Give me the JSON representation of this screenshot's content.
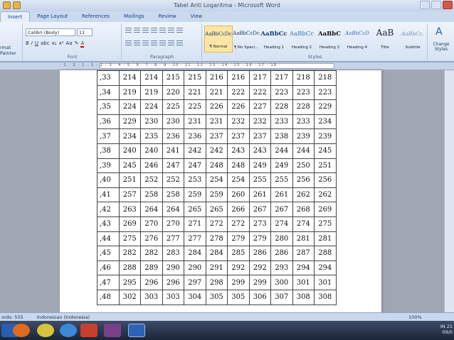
{
  "window": {
    "title": "Tabel Anti Logaritma - Microsoft Word"
  },
  "tabs": [
    "Insert",
    "Page Layout",
    "References",
    "Mailings",
    "Review",
    "View"
  ],
  "ribbon": {
    "clipboard": {
      "format_painter": "rmat Painter"
    },
    "font": {
      "name": "Calibri (Body)",
      "size": "11",
      "label": "Font"
    },
    "paragraph": {
      "label": "Paragraph"
    },
    "styles": {
      "label": "Styles",
      "items": [
        {
          "sample": "AaBbCcDc",
          "name": "¶ Normal"
        },
        {
          "sample": "AaBbCcDc",
          "name": "¶ No Spaci..."
        },
        {
          "sample": "AaBbCc",
          "name": "Heading 1"
        },
        {
          "sample": "AaBbCc",
          "name": "Heading 2"
        },
        {
          "sample": "AaBbC",
          "name": "Heading 3"
        },
        {
          "sample": "AaBbCcD",
          "name": "Heading 4"
        },
        {
          "sample": "AaB",
          "name": "Title"
        },
        {
          "sample": "AaBbCc.",
          "name": "Subtitle"
        }
      ],
      "change_styles": "Change Styles"
    }
  },
  "table": {
    "rows": [
      {
        "key": ",33",
        "values": [
          "214",
          "214",
          "215",
          "215",
          "216",
          "216",
          "217",
          "217",
          "218",
          "218"
        ]
      },
      {
        "key": ",34",
        "values": [
          "219",
          "219",
          "220",
          "221",
          "221",
          "222",
          "222",
          "223",
          "223",
          "223"
        ]
      },
      {
        "key": ",35",
        "values": [
          "224",
          "224",
          "225",
          "225",
          "226",
          "226",
          "227",
          "228",
          "228",
          "229"
        ]
      },
      {
        "key": ",36",
        "values": [
          "229",
          "230",
          "230",
          "231",
          "231",
          "232",
          "232",
          "233",
          "233",
          "234"
        ]
      },
      {
        "key": ",37",
        "values": [
          "234",
          "235",
          "236",
          "236",
          "237",
          "237",
          "237",
          "238",
          "239",
          "239"
        ]
      },
      {
        "key": ",38",
        "values": [
          "240",
          "240",
          "241",
          "242",
          "242",
          "243",
          "243",
          "244",
          "244",
          "245"
        ]
      },
      {
        "key": ",39",
        "values": [
          "245",
          "246",
          "247",
          "247",
          "248",
          "248",
          "249",
          "249",
          "250",
          "251"
        ]
      },
      {
        "key": ",40",
        "values": [
          "251",
          "252",
          "252",
          "253",
          "254",
          "254",
          "255",
          "255",
          "256",
          "256"
        ]
      },
      {
        "key": ",41",
        "values": [
          "257",
          "258",
          "258",
          "259",
          "259",
          "260",
          "261",
          "261",
          "262",
          "262"
        ]
      },
      {
        "key": ",42",
        "values": [
          "263",
          "264",
          "264",
          "265",
          "265",
          "266",
          "267",
          "267",
          "268",
          "269"
        ]
      },
      {
        "key": ",43",
        "values": [
          "269",
          "270",
          "270",
          "271",
          "272",
          "272",
          "273",
          "274",
          "274",
          "275"
        ]
      },
      {
        "key": ",44",
        "values": [
          "275",
          "276",
          "277",
          "277",
          "278",
          "279",
          "279",
          "280",
          "281",
          "281"
        ]
      },
      {
        "key": ",45",
        "values": [
          "282",
          "282",
          "283",
          "284",
          "284",
          "285",
          "286",
          "286",
          "287",
          "288"
        ]
      },
      {
        "key": ",46",
        "values": [
          "288",
          "289",
          "290",
          "290",
          "291",
          "292",
          "292",
          "293",
          "294",
          "294"
        ]
      },
      {
        "key": ",47",
        "values": [
          "295",
          "296",
          "296",
          "297",
          "298",
          "299",
          "299",
          "300",
          "301",
          "301"
        ]
      },
      {
        "key": ",48",
        "values": [
          "302",
          "303",
          "303",
          "304",
          "305",
          "305",
          "306",
          "307",
          "308",
          "308"
        ]
      }
    ]
  },
  "status": {
    "words": "ords: 555",
    "language": "Indonesian (Indonesia)",
    "zoom": "100%"
  },
  "tray": {
    "lang": "IN",
    "time": "21",
    "date": "09/0"
  }
}
